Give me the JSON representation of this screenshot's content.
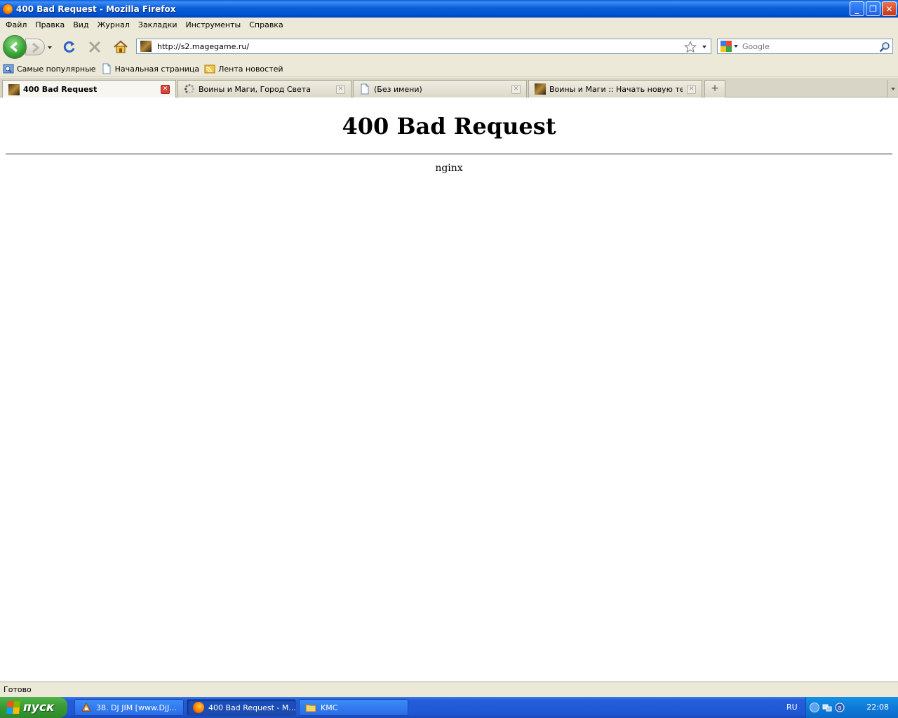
{
  "window": {
    "title": "400 Bad Request - Mozilla Firefox",
    "minimize": "_",
    "maximize": "❐",
    "close": "✕"
  },
  "menu": [
    "Файл",
    "Правка",
    "Вид",
    "Журнал",
    "Закладки",
    "Инструменты",
    "Справка"
  ],
  "navigation": {
    "url": "http://s2.magegame.ru/",
    "search_placeholder": "Google"
  },
  "bookmarks": [
    {
      "label": "Самые популярные",
      "icon": "most-visited-icon"
    },
    {
      "label": "Начальная страница",
      "icon": "page-icon"
    },
    {
      "label": "Лента новостей",
      "icon": "rss-feed-icon"
    }
  ],
  "tabs": [
    {
      "label": "400 Bad Request",
      "icon": "site-favicon",
      "active": true
    },
    {
      "label": "Воины и Маги, Город Света",
      "icon": "loading-spinner-icon",
      "active": false
    },
    {
      "label": "(Без имени)",
      "icon": "page-icon",
      "active": false
    },
    {
      "label": "Воины и Маги :: Начать новую тему",
      "icon": "site-favicon",
      "active": false
    }
  ],
  "content": {
    "heading": "400 Bad Request",
    "server": "nginx"
  },
  "status": "Готово",
  "taskbar": {
    "start_label": "пуск",
    "tasks": [
      {
        "label": "38. DJ JIM [www.DjJ...",
        "icon": "media-player-icon",
        "active": false
      },
      {
        "label": "400 Bad Request - M...",
        "icon": "firefox-icon",
        "active": true
      },
      {
        "label": "KMC",
        "icon": "folder-icon",
        "active": false
      }
    ],
    "language": "RU",
    "clock": "22:08"
  }
}
